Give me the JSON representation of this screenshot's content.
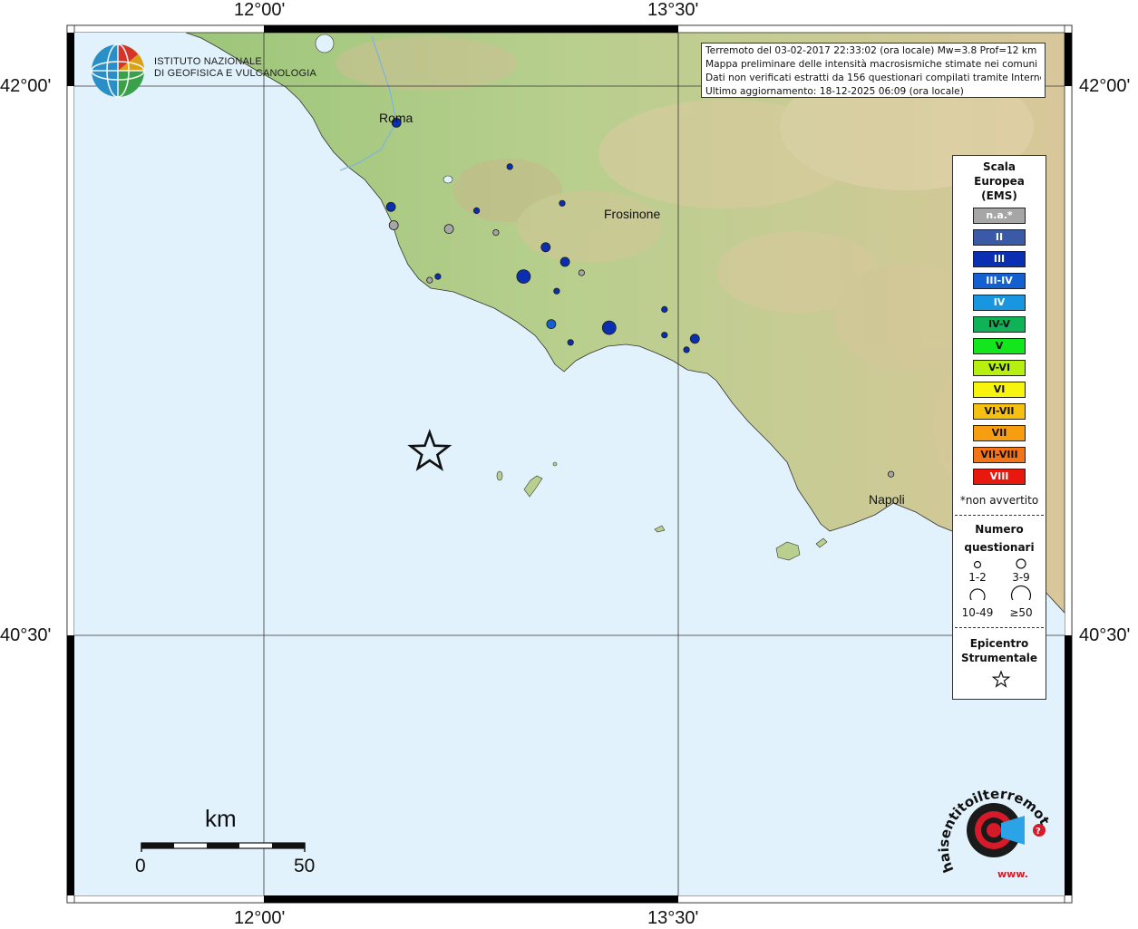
{
  "map": {
    "lat_labels": {
      "north": "42°00'",
      "south": "40°30'"
    },
    "lon_labels": {
      "west": "12°00'",
      "east": "13°30'"
    },
    "places": [
      {
        "name": "Roma",
        "lon": 12.48,
        "lat": 41.9
      },
      {
        "name": "Frosinone",
        "lon": 13.35,
        "lat": 41.64
      },
      {
        "name": "Napoli",
        "lon": 14.25,
        "lat": 40.85
      }
    ],
    "epicenter": {
      "lon": 12.6,
      "lat": 41.0
    },
    "observations": [
      {
        "lon": 12.48,
        "lat": 41.9,
        "intensity": "III",
        "count_class": "3-9"
      },
      {
        "lon": 12.89,
        "lat": 41.78,
        "intensity": "III",
        "count_class": "1-2"
      },
      {
        "lon": 13.08,
        "lat": 41.68,
        "intensity": "III",
        "count_class": "1-2"
      },
      {
        "lon": 12.46,
        "lat": 41.67,
        "intensity": "III",
        "count_class": "3-9"
      },
      {
        "lon": 12.77,
        "lat": 41.66,
        "intensity": "III",
        "count_class": "1-2"
      },
      {
        "lon": 12.47,
        "lat": 41.62,
        "intensity": "n.a.*",
        "count_class": "3-9"
      },
      {
        "lon": 12.67,
        "lat": 41.61,
        "intensity": "n.a.*",
        "count_class": "3-9"
      },
      {
        "lon": 12.84,
        "lat": 41.6,
        "intensity": "n.a.*",
        "count_class": "1-2"
      },
      {
        "lon": 13.02,
        "lat": 41.56,
        "intensity": "III",
        "count_class": "3-9"
      },
      {
        "lon": 13.09,
        "lat": 41.52,
        "intensity": "III",
        "count_class": "3-9"
      },
      {
        "lon": 13.15,
        "lat": 41.49,
        "intensity": "n.a.*",
        "count_class": "1-2"
      },
      {
        "lon": 12.94,
        "lat": 41.48,
        "intensity": "III",
        "count_class": "10-49"
      },
      {
        "lon": 12.63,
        "lat": 41.48,
        "intensity": "III",
        "count_class": "1-2"
      },
      {
        "lon": 12.6,
        "lat": 41.47,
        "intensity": "n.a.*",
        "count_class": "1-2"
      },
      {
        "lon": 13.06,
        "lat": 41.44,
        "intensity": "III",
        "count_class": "1-2"
      },
      {
        "lon": 13.45,
        "lat": 41.39,
        "intensity": "III",
        "count_class": "1-2"
      },
      {
        "lon": 13.04,
        "lat": 41.35,
        "intensity": "III-IV",
        "count_class": "3-9"
      },
      {
        "lon": 13.25,
        "lat": 41.34,
        "intensity": "III",
        "count_class": "10-49"
      },
      {
        "lon": 13.56,
        "lat": 41.31,
        "intensity": "III",
        "count_class": "3-9"
      },
      {
        "lon": 13.45,
        "lat": 41.32,
        "intensity": "III",
        "count_class": "1-2"
      },
      {
        "lon": 13.11,
        "lat": 41.3,
        "intensity": "III",
        "count_class": "1-2"
      },
      {
        "lon": 13.53,
        "lat": 41.28,
        "intensity": "III",
        "count_class": "1-2"
      },
      {
        "lon": 14.27,
        "lat": 40.94,
        "intensity": "n.a.*",
        "count_class": "1-2"
      }
    ]
  },
  "logo": {
    "line1": "ISTITUTO NAZIONALE",
    "line2": "DI GEOFISICA E VULCANOLOGIA"
  },
  "info": {
    "line1": "Terremoto del 03-02-2017 22:33:02 (ora locale) Mw=3.8 Prof=12 km",
    "line2": "Mappa preliminare delle intensità macrosismiche stimate nei comuni",
    "line3": "Dati non verificati estratti da 156 questionari compilati tramite Internet.",
    "line4": "Ultimo aggiornamento: 18-12-2025 06:09 (ora locale)"
  },
  "legend": {
    "title": [
      "Scala",
      "Europea",
      "(EMS)"
    ],
    "ems": [
      {
        "label": "n.a.*",
        "color": "#a6a6a6",
        "text": "#ffffff"
      },
      {
        "label": "II",
        "color": "#3a5aa8",
        "text": "#ffffff"
      },
      {
        "label": "III",
        "color": "#0a2fb3",
        "text": "#ffffff"
      },
      {
        "label": "III-IV",
        "color": "#1560d0",
        "text": "#ffffff"
      },
      {
        "label": "IV",
        "color": "#1896e0",
        "text": "#ffffff"
      },
      {
        "label": "IV-V",
        "color": "#10b258",
        "text": "#111111"
      },
      {
        "label": "V",
        "color": "#13e61c",
        "text": "#111111"
      },
      {
        "label": "V-VI",
        "color": "#b6f010",
        "text": "#111111"
      },
      {
        "label": "VI",
        "color": "#f7f40e",
        "text": "#111111"
      },
      {
        "label": "VI-VII",
        "color": "#f6c010",
        "text": "#111111"
      },
      {
        "label": "VII",
        "color": "#f79e10",
        "text": "#111111"
      },
      {
        "label": "VII-VIII",
        "color": "#f47518",
        "text": "#111111"
      },
      {
        "label": "VIII",
        "color": "#e8180e",
        "text": "#ffffff"
      }
    ],
    "not_felt_note": "*non avvertito",
    "questionnaires_title": [
      "Numero",
      "questionari"
    ],
    "count_classes": [
      "1-2",
      "3-9",
      "10-49",
      "≥50"
    ],
    "epicenter_title": [
      "Epicentro",
      "Strumentale"
    ]
  },
  "scalebar": {
    "unit": "km",
    "start": "0",
    "end": "50"
  },
  "hsit": {
    "text": "haisentitoilterremoto.it",
    "prefix": "www."
  }
}
